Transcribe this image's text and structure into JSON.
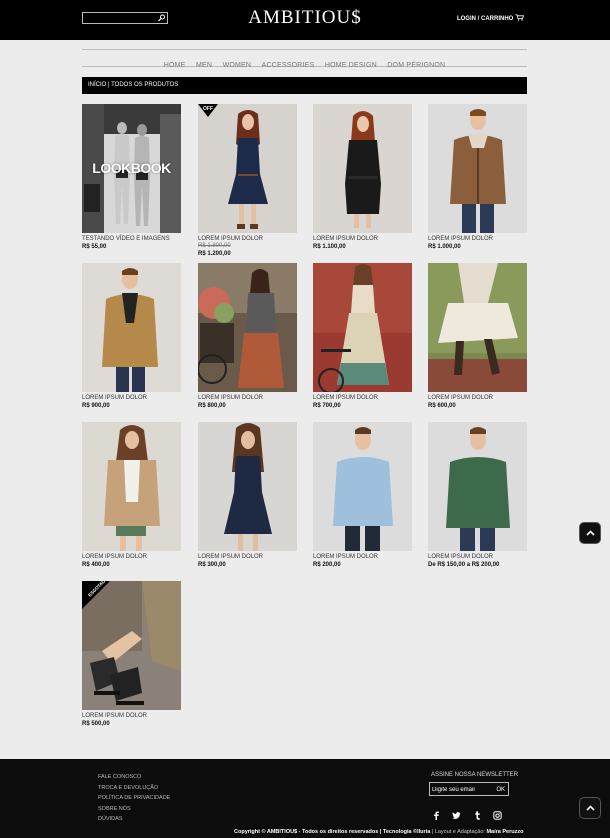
{
  "header": {
    "logo": "AMBITIOU$",
    "search": {
      "placeholder": "",
      "value": ""
    },
    "login_label": "LOGIN",
    "separator": "/",
    "cart_label": "CARRINHO"
  },
  "nav": {
    "items": [
      "HOME",
      "MEN",
      "WOMEN",
      "ACCESSORIES",
      "HOME DESIGN",
      "DOM PÉRIGNON"
    ]
  },
  "breadcrumb": {
    "text": "INÍCIO | TODOS OS PRODUTOS"
  },
  "products": [
    {
      "name": "TESTANDO VÍDEO E IMAGENS",
      "price": "R$ 55,00",
      "overlay": "LOOKBOOK"
    },
    {
      "name": "LOREM IPSUM DOLOR",
      "old_price": "R$ 1.800,00",
      "price": "R$ 1.200,00",
      "badge": "OFF"
    },
    {
      "name": "LOREM IPSUM DOLOR",
      "price": "R$ 1.100,00"
    },
    {
      "name": "LOREM IPSUM DOLOR",
      "price": "R$ 1.000,00"
    },
    {
      "name": "LOREM IPSUM DOLOR",
      "price": "R$ 900,00"
    },
    {
      "name": "LOREM IPSUM DOLOR",
      "price": "R$ 800,00"
    },
    {
      "name": "LOREM IPSUM DOLOR",
      "price": "R$ 700,00"
    },
    {
      "name": "LOREM IPSUM DOLOR",
      "price": "R$ 600,00"
    },
    {
      "name": "LOREM IPSUM DOLOR",
      "price": "R$ 400,00"
    },
    {
      "name": "LOREM IPSUM DOLOR",
      "price": "R$ 300,00"
    },
    {
      "name": "LOREM IPSUM DOLOR",
      "price": "R$ 200,00"
    },
    {
      "name": "LOREM IPSUM DOLOR",
      "price": "De R$ 150,00 a R$ 200,00"
    },
    {
      "name": "LOREM IPSUM DOLOR",
      "price": "R$ 500,00",
      "badge": "ESGOTADO"
    }
  ],
  "footer": {
    "links": [
      "FALE CONOSCO",
      "TROCA E DEVOLUÇÃO",
      "POLÍTICA DE PRIVACIDADE",
      "SOBRE NÓS",
      "DÚVIDAS"
    ],
    "newsletter_title": "ASSINE NOSSA NEWSLETTER",
    "newsletter_placeholder": "Digite seu email",
    "newsletter_button": "OK",
    "social_icons": [
      "facebook-icon",
      "twitter-icon",
      "tumblr-icon",
      "instagram-icon"
    ],
    "copyright_prefix": "Copyright © AMBITIOU$ - Todos os direitos reservados |",
    "copyright_tech": "Tecnologia ©Iluria",
    "copyright_mid": "| Layout e Adaptação:",
    "copyright_author": "Maíra Peruzzo"
  },
  "colors": {
    "header_bg": "#000000",
    "page_bg": "#ececec",
    "footer_bg": "#0c0c0c",
    "nav_text": "#777777"
  }
}
